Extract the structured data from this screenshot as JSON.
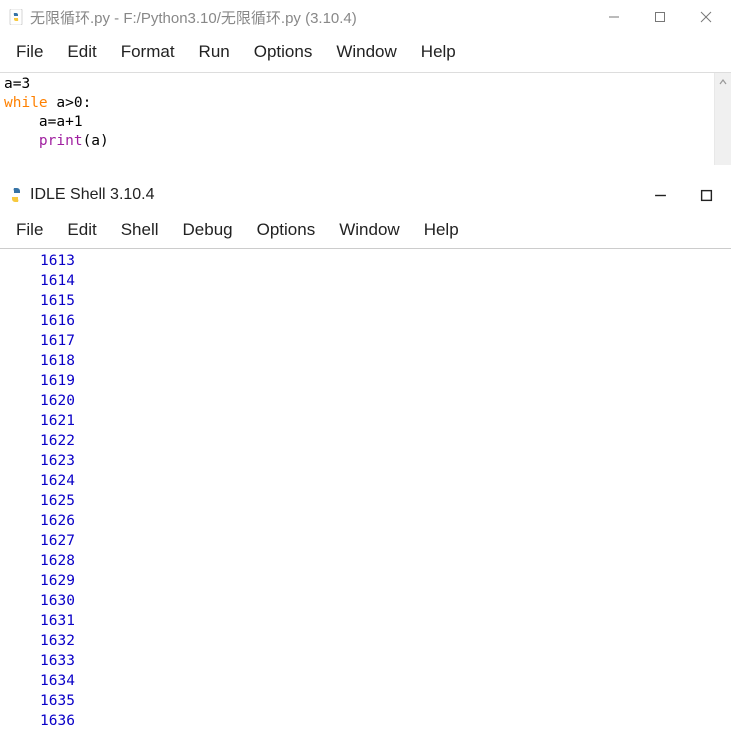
{
  "editor": {
    "title": "无限循环.py - F:/Python3.10/无限循环.py (3.10.4)",
    "menu": {
      "file": "File",
      "edit": "Edit",
      "format": "Format",
      "run": "Run",
      "options": "Options",
      "window": "Window",
      "help": "Help"
    },
    "code": {
      "l1": "a=3",
      "l2_kw": "while",
      "l2_rest": " a>0:",
      "l3": "    a=a+1",
      "l4_pre": "    ",
      "l4_fn": "print",
      "l4_post": "(a)"
    }
  },
  "shell": {
    "title": "IDLE Shell 3.10.4",
    "menu": {
      "file": "File",
      "edit": "Edit",
      "shell": "Shell",
      "debug": "Debug",
      "options": "Options",
      "window": "Window",
      "help": "Help"
    },
    "output": [
      "1613",
      "1614",
      "1615",
      "1616",
      "1617",
      "1618",
      "1619",
      "1620",
      "1621",
      "1622",
      "1623",
      "1624",
      "1625",
      "1626",
      "1627",
      "1628",
      "1629",
      "1630",
      "1631",
      "1632",
      "1633",
      "1634",
      "1635",
      "1636"
    ]
  }
}
